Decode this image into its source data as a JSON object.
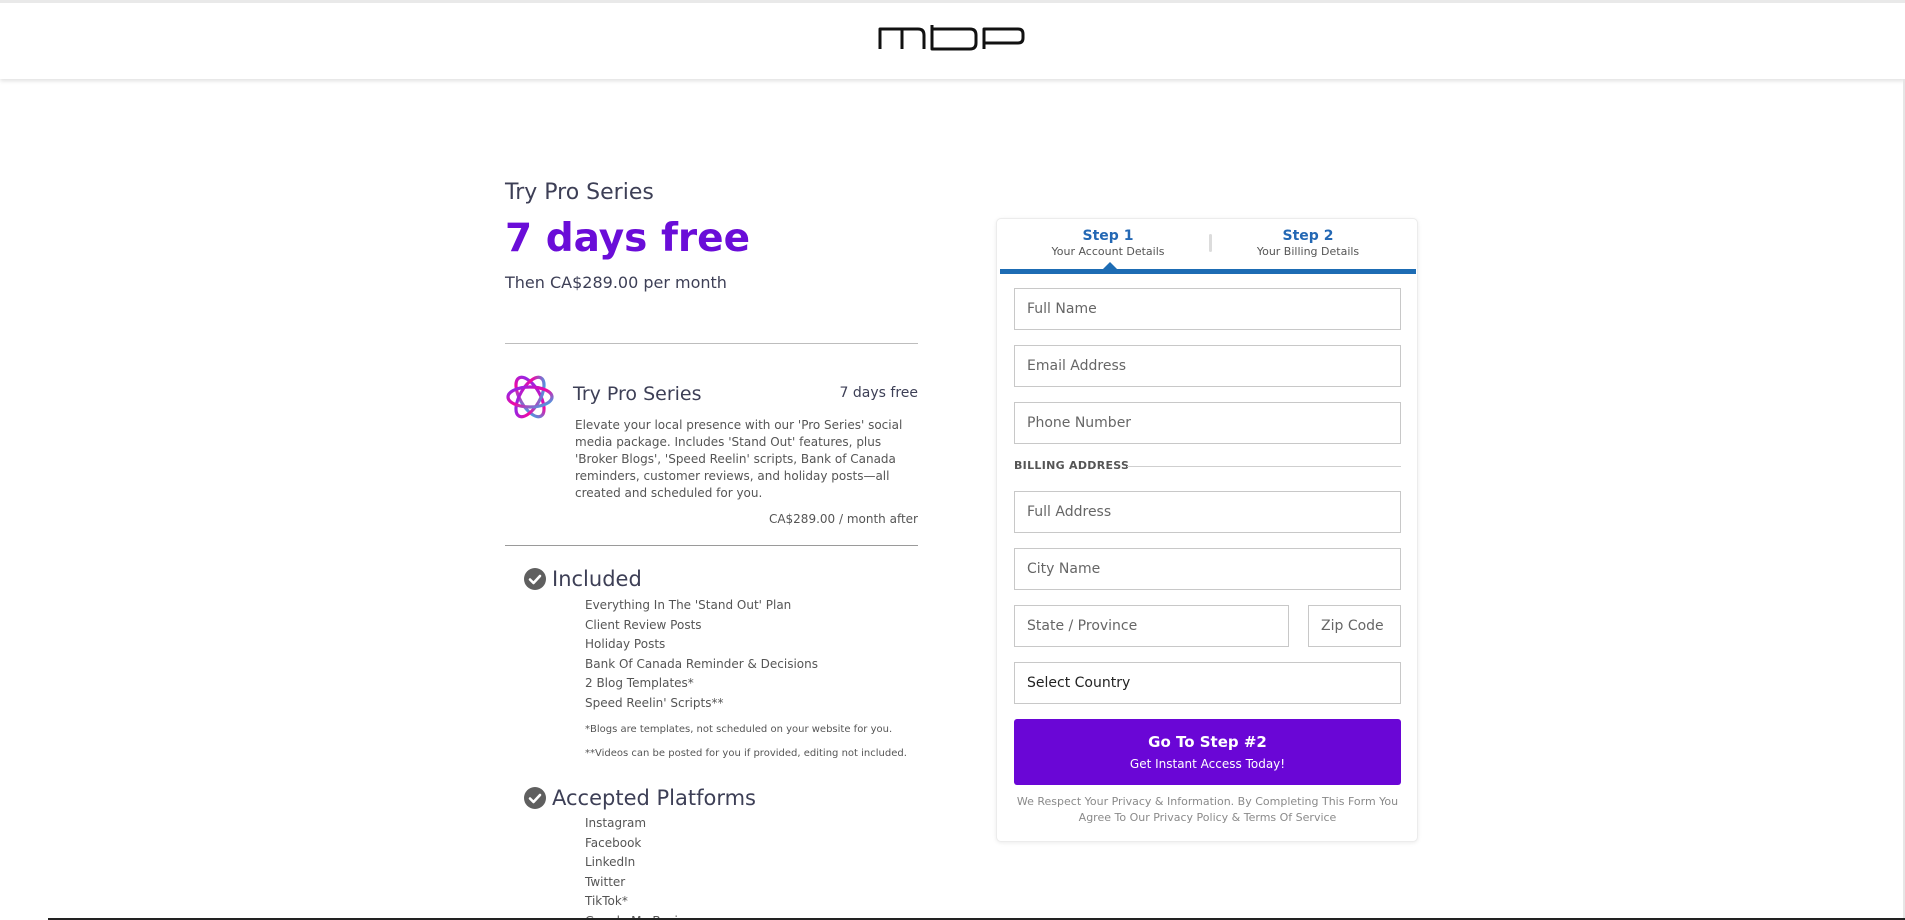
{
  "header": {
    "logo_text": "MBP"
  },
  "offer": {
    "eyebrow": "Try Pro Series",
    "headline": "7 days free",
    "price_line": "Then CA$289.00 per month"
  },
  "product": {
    "icon": "atom-orbit-icon",
    "name": "Try Pro Series",
    "trial": "7 days free",
    "description": "Elevate your local presence with our 'Pro Series' social media package. Includes 'Stand Out' features, plus 'Broker Blogs', 'Speed Reelin' scripts, Bank of Canada reminders, customer reviews, and holiday posts—all created and scheduled for you.",
    "after_price": "CA$289.00 / month after"
  },
  "included": {
    "title": "Included",
    "items": [
      "Everything In The 'Stand Out' Plan",
      "Client Review Posts",
      "Holiday Posts",
      "Bank Of Canada Reminder & Decisions",
      "2 Blog Templates*",
      "Speed Reelin' Scripts**"
    ],
    "note1": "*Blogs are templates, not scheduled on your website for you.",
    "note2": "**Videos can be posted for you if provided, editing not included."
  },
  "platforms": {
    "title": "Accepted Platforms",
    "items": [
      "Instagram",
      "Facebook",
      "LinkedIn",
      "Twitter",
      "TikTok*",
      "Google My Business"
    ]
  },
  "steps": [
    {
      "title": "Step 1",
      "subtitle": "Your Account Details"
    },
    {
      "title": "Step 2",
      "subtitle": "Your Billing Details"
    }
  ],
  "form": {
    "full_name_placeholder": "Full Name",
    "email_placeholder": "Email Address",
    "phone_placeholder": "Phone Number",
    "billing_label": "BILLING ADDRESS",
    "address_placeholder": "Full Address",
    "city_placeholder": "City Name",
    "state_placeholder": "State / Province",
    "zip_placeholder": "Zip Code",
    "country_selected": "Select Country",
    "cta_main": "Go To Step #2",
    "cta_sub": "Get Instant Access Today!",
    "privacy": "We Respect Your Privacy & Information. By Completing This Form You Agree To Our Privacy Policy & Terms Of Service"
  },
  "colors": {
    "brand_purple": "#6a0dd8",
    "step_blue": "#1d6cb4"
  }
}
